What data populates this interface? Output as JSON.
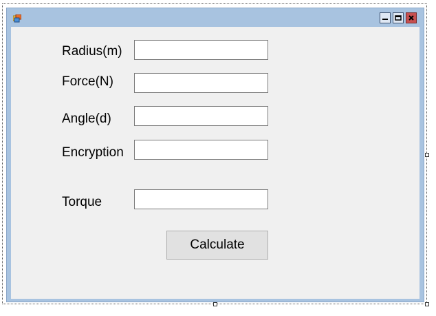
{
  "form": {
    "title": "",
    "fields": [
      {
        "label": "Radius(m)",
        "value": ""
      },
      {
        "label": "Force(N)",
        "value": ""
      },
      {
        "label": "Angle(d)",
        "value": ""
      },
      {
        "label": "Encryption",
        "value": ""
      },
      {
        "label": "Torque",
        "value": ""
      }
    ],
    "calculate_label": "Calculate"
  },
  "icons": {
    "app": "app-icon",
    "minimize": "minimize-icon",
    "maximize": "maximize-icon",
    "close": "close-icon"
  },
  "colors": {
    "title_bar": "#a8c3e0",
    "client_bg": "#f0f0f0",
    "close_button": "#c75050"
  }
}
